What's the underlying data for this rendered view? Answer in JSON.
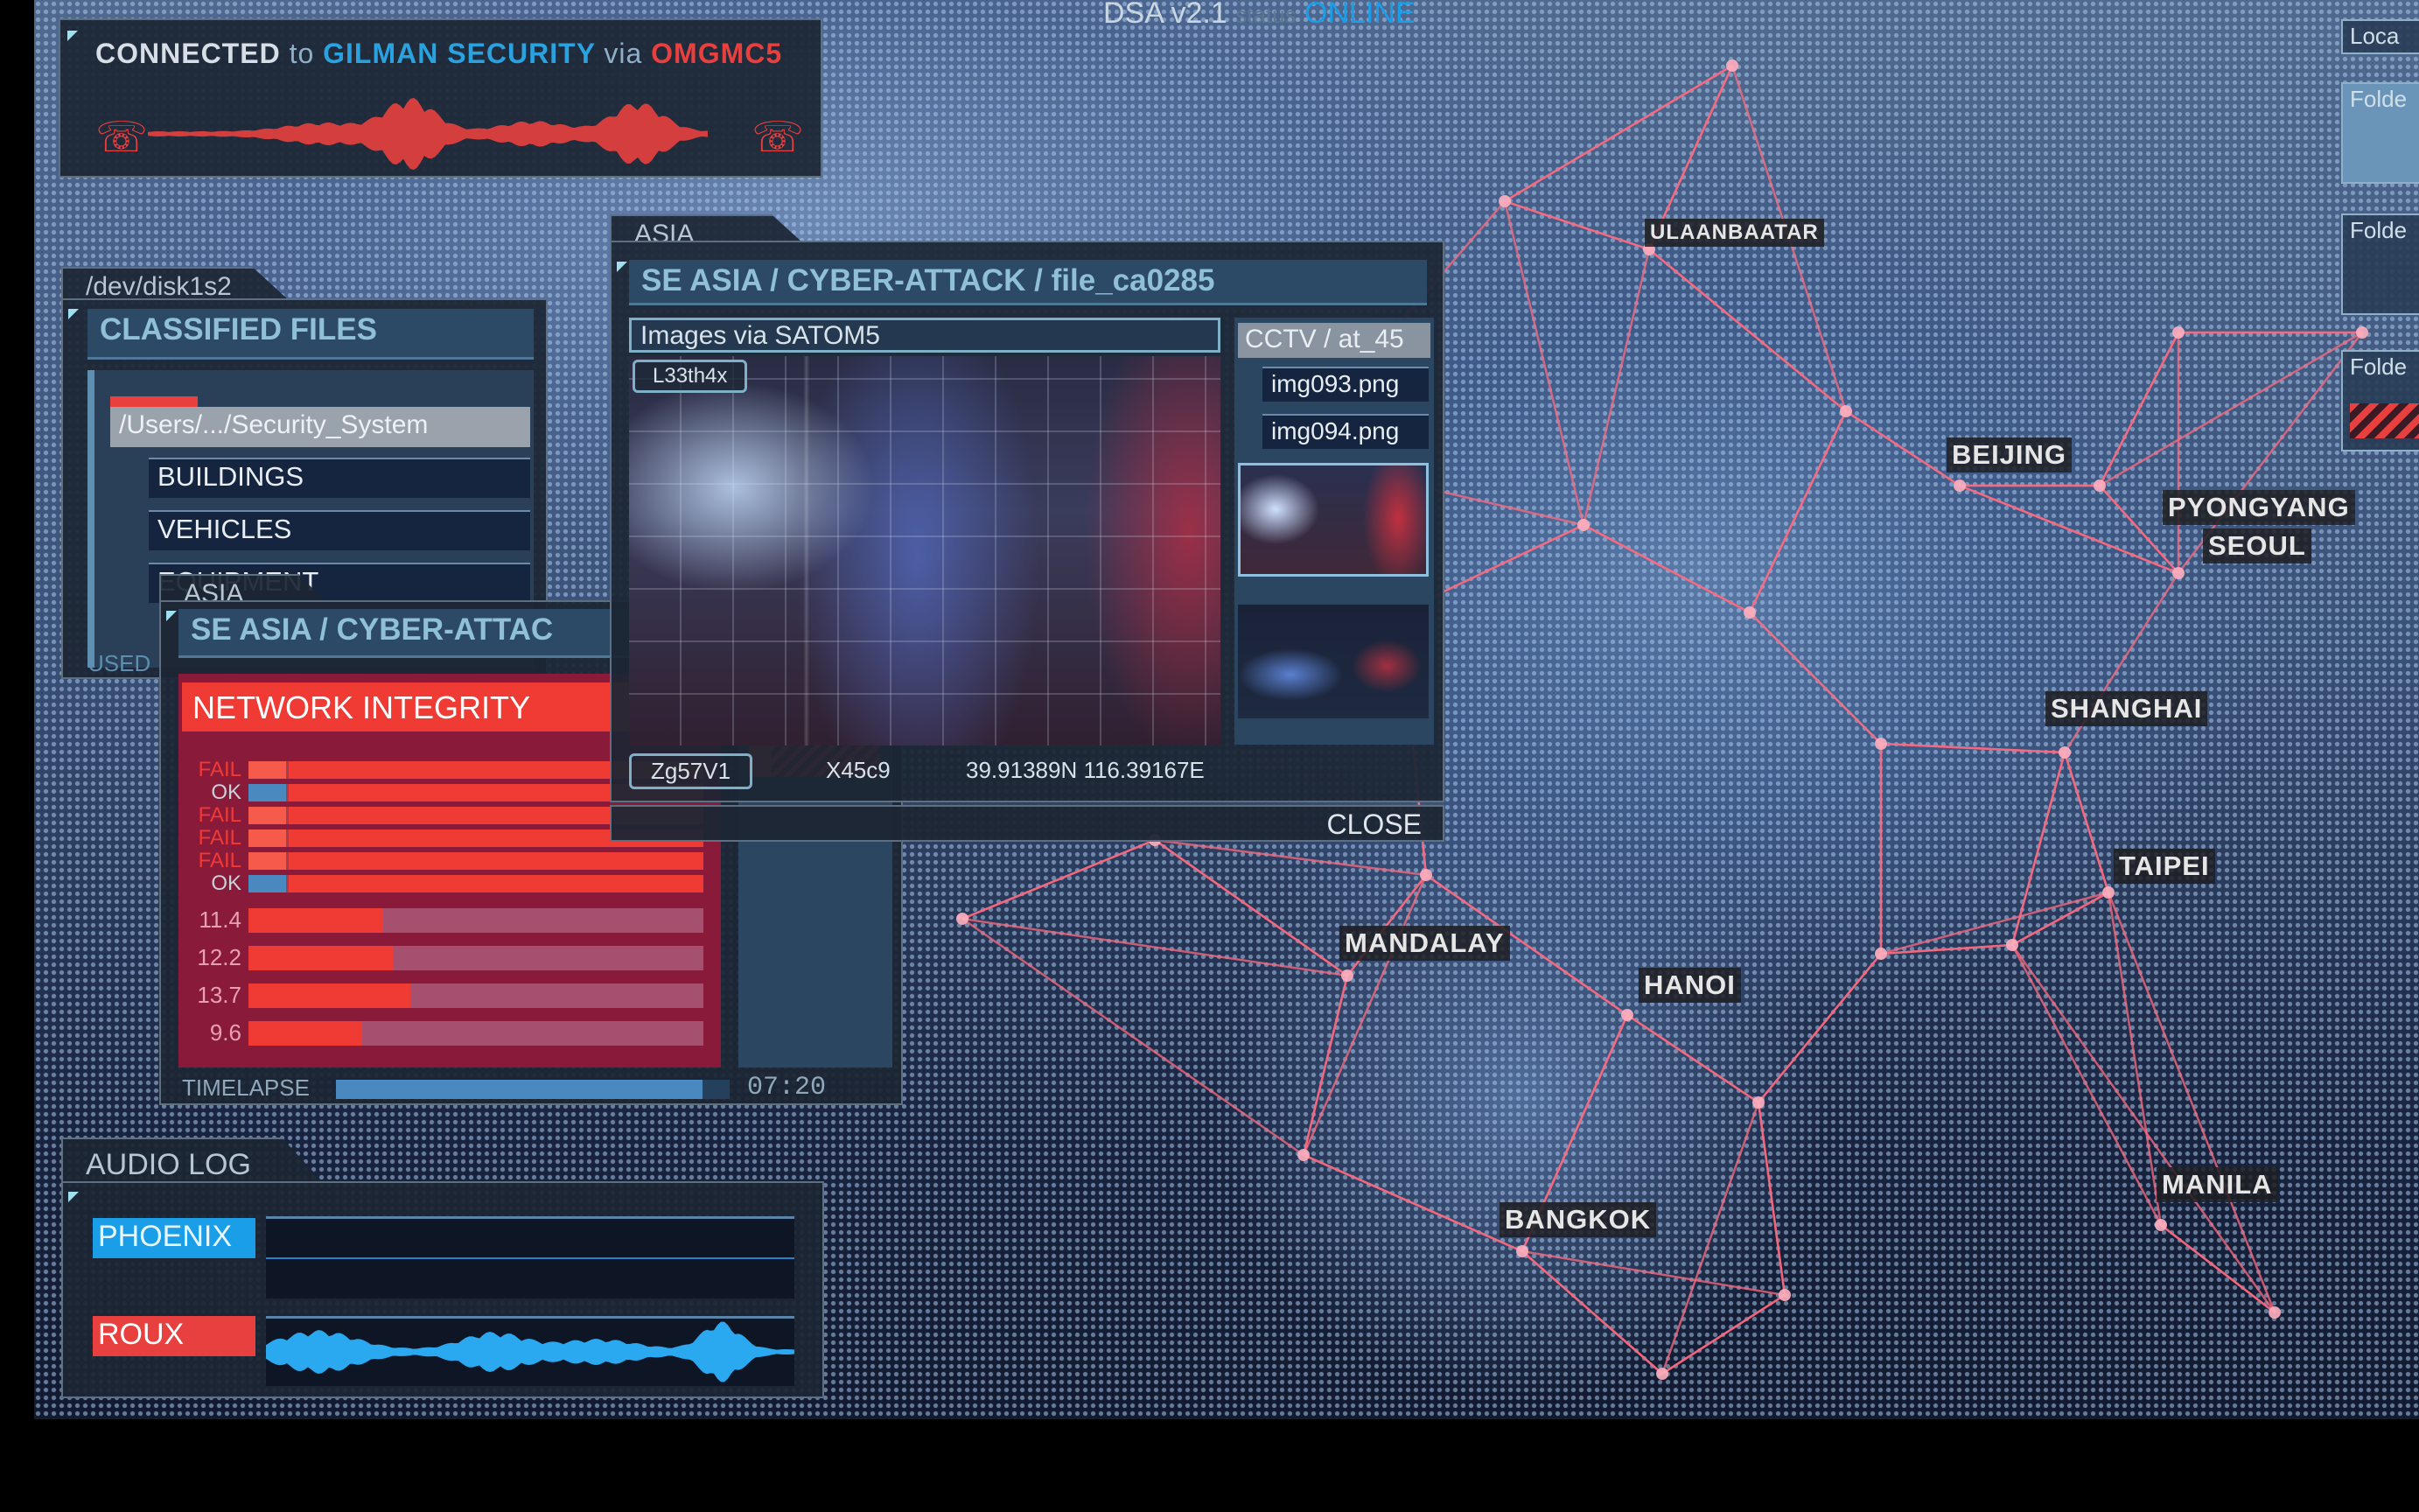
{
  "header": {
    "app": "DSA v2.1",
    "status_label": "status",
    "status_value": "ONLINE"
  },
  "connection": {
    "prefix": "CONNECTED",
    "to": "to",
    "target": "GILMAN SECURITY",
    "via": "via",
    "channel": "OMGMC5"
  },
  "classified": {
    "tab": "/dev/disk1s2",
    "title": "CLASSIFIED FILES",
    "path": "/Users/.../Security_System",
    "items": [
      "BUILDINGS",
      "VEHICLES",
      "EQUIPMENT"
    ],
    "footer": "USED"
  },
  "network": {
    "tab": "ASIA",
    "title": "SE ASIA / CYBER-ATTAC",
    "heading": "NETWORK INTEGRITY",
    "status_rows": [
      {
        "label": "FAIL",
        "state": "fail"
      },
      {
        "label": "OK",
        "state": "ok"
      },
      {
        "label": "FAIL",
        "state": "fail"
      },
      {
        "label": "FAIL",
        "state": "fail"
      },
      {
        "label": "FAIL",
        "state": "fail"
      },
      {
        "label": "OK",
        "state": "ok"
      }
    ],
    "value_rows": [
      {
        "label": "11.4",
        "value": 11.4
      },
      {
        "label": "12.2",
        "value": 12.2
      },
      {
        "label": "13.7",
        "value": 13.7
      },
      {
        "label": "9.6",
        "value": 9.6
      }
    ],
    "timelapse_label": "TIMELAPSE",
    "timelapse_progress": 0.93,
    "time": "07:20"
  },
  "viewer": {
    "tab": "ASIA",
    "title": "SE ASIA / CYBER-ATTACK / file_ca0285",
    "source": "Images via SATOM5",
    "tag": "L33th4x",
    "cctv": "CCTV / at_45",
    "files": [
      "img093.png",
      "img094.png"
    ],
    "code": "Zg57V1",
    "id": "X45c9",
    "coords": "39.91389N 116.39167E",
    "close": "CLOSE"
  },
  "audio": {
    "title": "AUDIO LOG",
    "tracks": [
      {
        "name": "PHOENIX",
        "color": "#1a9ee8"
      },
      {
        "name": "ROUX",
        "color": "#e8403e"
      }
    ]
  },
  "right_panel": {
    "items": [
      "Loca",
      "Folde",
      "Folde",
      "Folde"
    ]
  },
  "map": {
    "cities": [
      "ULAANBAATAR",
      "BEIJING",
      "PYONGYANG",
      "SEOUL",
      "SHANGHAI",
      "TAIPEI",
      "MANDALAY",
      "HANOI",
      "BANGKOK",
      "MANILA"
    ]
  },
  "colors": {
    "accent_red": "#f03a34",
    "accent_blue": "#1a9ee8",
    "link_line": "#ff6a80"
  }
}
